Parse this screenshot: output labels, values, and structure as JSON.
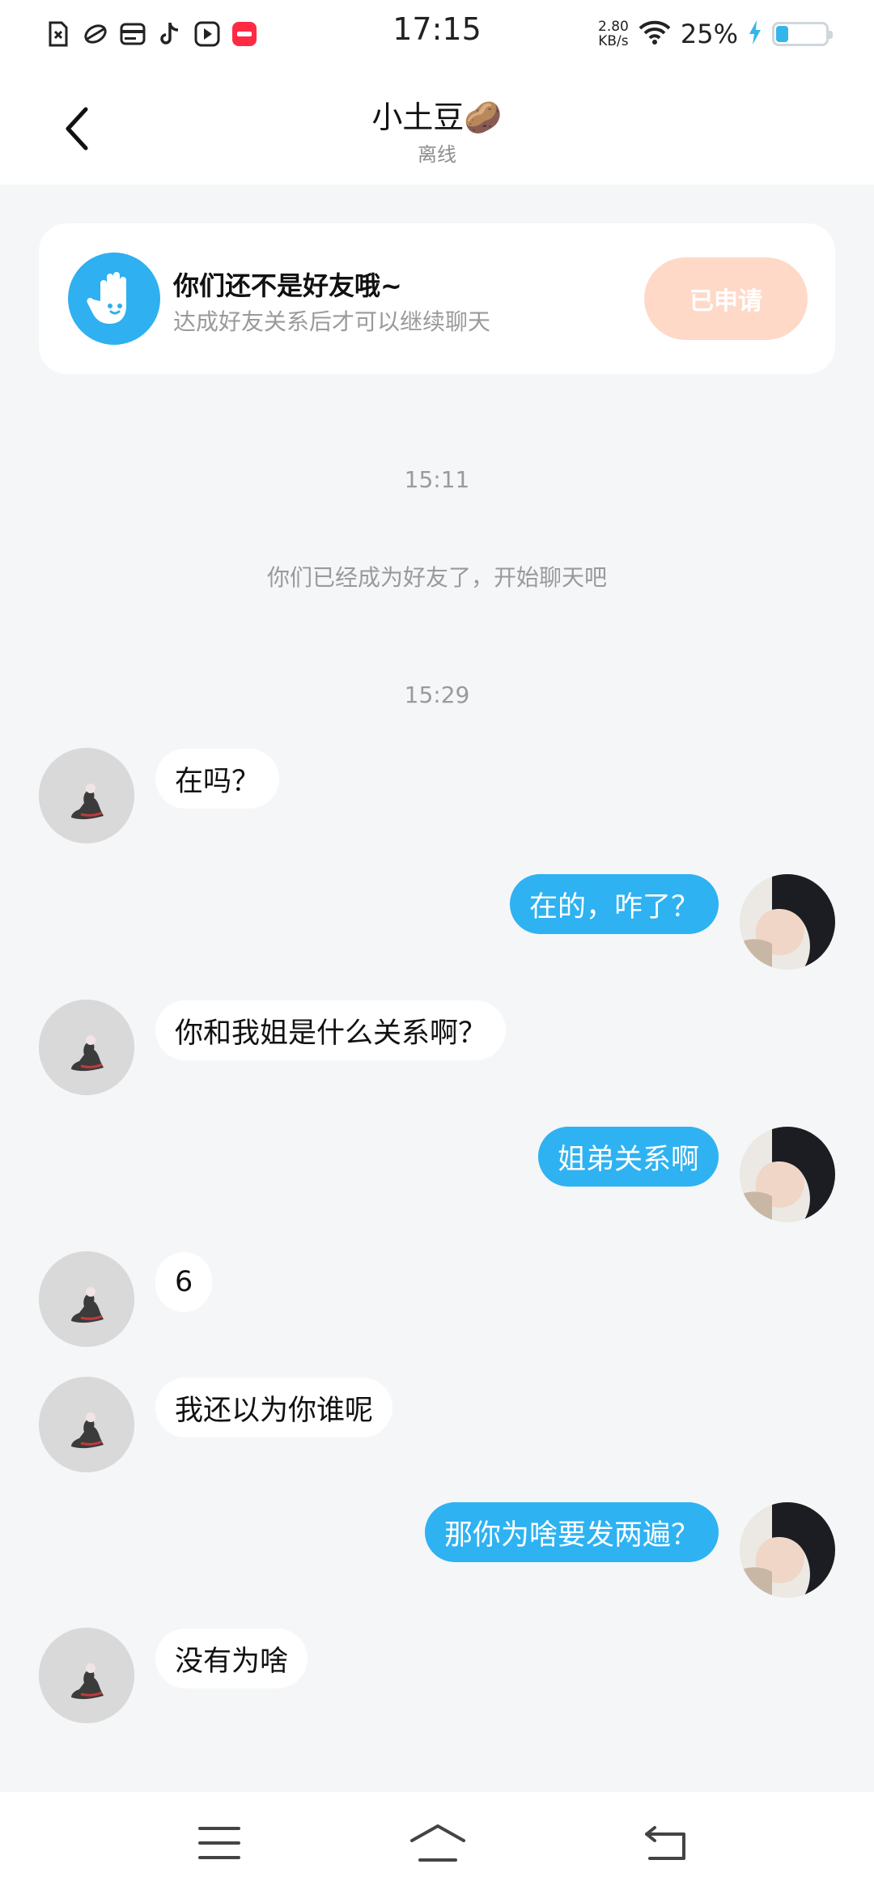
{
  "status_bar": {
    "time": "17:15",
    "net_speed_value": "2.80",
    "net_speed_unit": "KB/s",
    "battery_percent": "25%",
    "battery_level": 0.25,
    "icons": [
      "sim-alert-icon",
      "app-icon",
      "card-icon",
      "tiktok-icon",
      "video-icon",
      "red-app-icon",
      "wifi-icon",
      "charging-bolt-icon",
      "battery-icon"
    ]
  },
  "header": {
    "title": "小土豆🥔",
    "subtitle": "离线"
  },
  "banner": {
    "title": "你们还不是好友哦~",
    "subtitle": "达成好友关系后才可以继续聊天",
    "button_label": "已申请"
  },
  "timeline": {
    "time1": "15:11",
    "system_message": "你们已经成为好友了，开始聊天吧",
    "time2": "15:29"
  },
  "messages": [
    {
      "side": "left",
      "text": "在吗？"
    },
    {
      "side": "right",
      "text": "在的，咋了？"
    },
    {
      "side": "left",
      "text": "你和我姐是什么关系啊？"
    },
    {
      "side": "right",
      "text": "姐弟关系啊"
    },
    {
      "side": "left",
      "text": "6"
    },
    {
      "side": "left",
      "text": "我还以为你谁呢"
    },
    {
      "side": "right",
      "text": "那你为啥要发两遍？"
    },
    {
      "side": "left",
      "text": "没有为啥"
    }
  ],
  "colors": {
    "accent_blue": "#2eb2f2",
    "applied_button": "#ffd9c8",
    "background": "#f5f6f7"
  },
  "navbar": {
    "icons": [
      "menu-icon",
      "home-icon",
      "back-return-icon"
    ]
  }
}
